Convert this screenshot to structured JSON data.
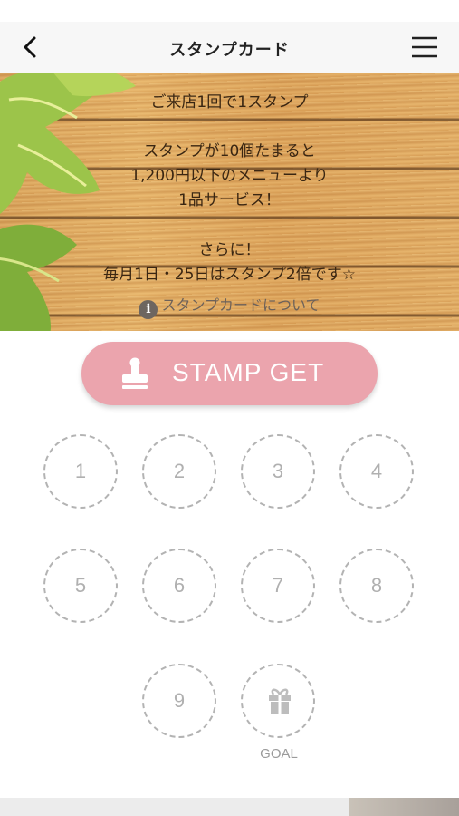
{
  "header": {
    "title": "スタンプカード",
    "back_icon": "chevron-left-icon",
    "menu_icon": "hamburger-menu-icon"
  },
  "banner": {
    "line1": "ご来店1回で1スタンプ",
    "line2": "スタンプが10個たまると",
    "line3": "1,200円以下のメニューより",
    "line4": "1品サービス！",
    "line5": "さらに！",
    "line6": "毎月1日・25日はスタンプ2倍です☆",
    "info_icon": "info-circle-icon",
    "info_link": "スタンプカードについて"
  },
  "stamp_button": {
    "label": "STAMP GET",
    "icon": "stamp-icon",
    "color": "#eba4ad"
  },
  "slots": [
    "1",
    "2",
    "3",
    "4",
    "5",
    "6",
    "7",
    "8",
    "9"
  ],
  "goal": {
    "label": "GOAL",
    "icon": "gift-icon"
  }
}
